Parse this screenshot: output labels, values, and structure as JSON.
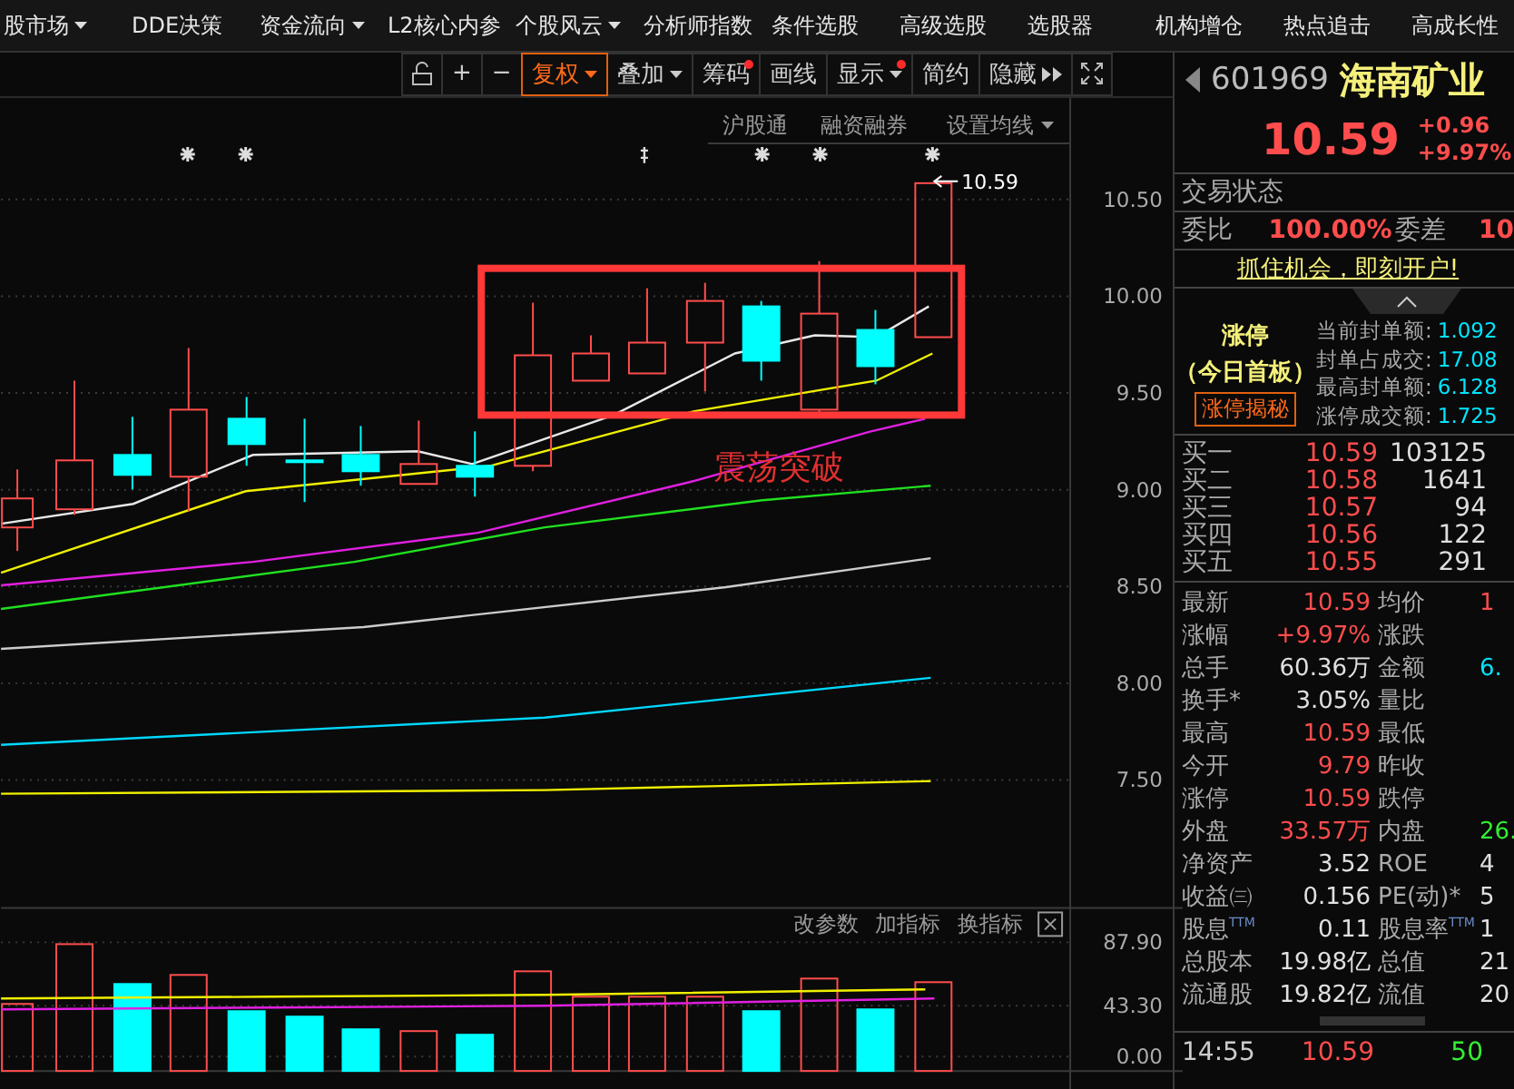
{
  "menu": [
    {
      "label": "股市场",
      "dropdown": true
    },
    {
      "label": "DDE决策",
      "dropdown": false
    },
    {
      "label": "资金流向",
      "dropdown": true
    },
    {
      "label": "L2核心内参",
      "dropdown": false
    },
    {
      "label": "个股风云",
      "dropdown": true
    },
    {
      "label": "分析师指数",
      "dropdown": false
    },
    {
      "label": "条件选股",
      "dropdown": false
    },
    {
      "label": "高级选股",
      "dropdown": false
    },
    {
      "label": "选股器",
      "dropdown": false
    },
    {
      "label": "机构增仓",
      "dropdown": false
    },
    {
      "label": "热点追击",
      "dropdown": false
    },
    {
      "label": "高成长性",
      "dropdown": false
    }
  ],
  "toolbar": [
    {
      "label": "+",
      "selected": false,
      "dropdown": false,
      "alert": false,
      "more": false
    },
    {
      "label": "−",
      "selected": false,
      "dropdown": false,
      "alert": false,
      "more": false
    },
    {
      "label": "复权",
      "selected": true,
      "dropdown": true,
      "alert": false,
      "more": false
    },
    {
      "label": "叠加",
      "selected": false,
      "dropdown": true,
      "alert": false,
      "more": false
    },
    {
      "label": "筹码",
      "selected": false,
      "dropdown": false,
      "alert": true,
      "more": false
    },
    {
      "label": "画线",
      "selected": false,
      "dropdown": false,
      "alert": false,
      "more": false
    },
    {
      "label": "显示",
      "selected": false,
      "dropdown": true,
      "alert": true,
      "more": false
    },
    {
      "label": "简约",
      "selected": false,
      "dropdown": false,
      "alert": false,
      "more": false
    },
    {
      "label": "隐藏",
      "selected": false,
      "dropdown": false,
      "alert": false,
      "more": true
    }
  ],
  "chart": {
    "links": [
      {
        "label": "沪股通",
        "dropdown": false
      },
      {
        "label": "融资融券",
        "dropdown": false
      },
      {
        "label": "设置均线",
        "dropdown": true
      }
    ],
    "price_ticks": [
      "10.50",
      "10.00",
      "9.50",
      "9.00",
      "8.50",
      "8.00",
      "7.50"
    ],
    "last_price_label": "10.59",
    "annotation": "震荡突破"
  },
  "volume": {
    "buttons": [
      "改参数",
      "加指标",
      "换指标"
    ],
    "ticks": [
      "87.90",
      "43.30",
      "0.00"
    ]
  },
  "quote": {
    "code": "601969",
    "name": "海南矿业",
    "price": "10.59",
    "change": "+0.96",
    "change_pct": "+9.97%",
    "status_label": "交易状态",
    "ratio_label": "委比",
    "ratio": "100.00%",
    "diff_label": "委差",
    "diff": "10",
    "promo": "抓住机会，即刻开户!",
    "limit": {
      "title": "涨停",
      "subtitle": "（今日首板）",
      "button": "涨停揭秘",
      "stats": [
        {
          "label": "当前封单额:",
          "value": "1.092"
        },
        {
          "label": "封单占成交:",
          "value": "17.08"
        },
        {
          "label": "最高封单额:",
          "value": "6.128"
        },
        {
          "label": "涨停成交额:",
          "value": "1.725"
        }
      ]
    },
    "bids": [
      {
        "label": "买一",
        "price": "10.59",
        "volume": "103125"
      },
      {
        "label": "买二",
        "price": "10.58",
        "volume": "1641"
      },
      {
        "label": "买三",
        "price": "10.57",
        "volume": "94"
      },
      {
        "label": "买四",
        "price": "10.56",
        "volume": "122"
      },
      {
        "label": "买五",
        "price": "10.55",
        "volume": "291"
      }
    ],
    "stats": [
      [
        {
          "label": "最新",
          "value": "10.59",
          "color": "#ff4d4d"
        },
        {
          "label": "均价",
          "value": "1",
          "color": "#ff4d4d"
        }
      ],
      [
        {
          "label": "涨幅",
          "value": "+9.97%",
          "color": "#ff4d4d"
        },
        {
          "label": "涨跌"
        }
      ],
      [
        {
          "label": "总手",
          "value": "60.36万",
          "color": "#e0e0e0"
        },
        {
          "label": "金额",
          "value": "6.",
          "color": "#00e5ff"
        }
      ],
      [
        {
          "label": "换手*",
          "value": "3.05%",
          "color": "#e0e0e0"
        },
        {
          "label": "量比"
        }
      ],
      [
        {
          "label": "最高",
          "value": "10.59",
          "color": "#ff4d4d"
        },
        {
          "label": "最低"
        }
      ],
      [
        {
          "label": "今开",
          "value": "9.79",
          "color": "#ff4d4d"
        },
        {
          "label": "昨收"
        }
      ],
      [
        {
          "label": "涨停",
          "value": "10.59",
          "color": "#ff4d4d"
        },
        {
          "label": "跌停"
        }
      ],
      [
        {
          "label": "外盘",
          "value": "33.57万",
          "color": "#ff4d4d"
        },
        {
          "label": "内盘",
          "value": "26.",
          "color": "#33ee33"
        }
      ],
      [
        {
          "label": "净资产",
          "value": "3.52",
          "color": "#e0e0e0"
        },
        {
          "label": "ROE",
          "value": "4",
          "color": "#e0e0e0"
        }
      ],
      [
        {
          "label": "收益㈢",
          "value": "0.156",
          "color": "#e0e0e0"
        },
        {
          "label": "PE(动)*",
          "value": "5",
          "color": "#e0e0e0"
        }
      ],
      [
        {
          "label": "股息$^{TTM}$",
          "value": "0.11",
          "color": "#e0e0e0"
        },
        {
          "label": "股息率$^{TTM}$",
          "value": "1",
          "color": "#e0e0e0"
        }
      ],
      [
        {
          "label": "总股本",
          "value": "19.98亿",
          "color": "#e0e0e0"
        },
        {
          "label": "总值",
          "value": "21",
          "color": "#e0e0e0"
        }
      ],
      [
        {
          "label": "流通股",
          "value": "19.82亿",
          "color": "#e0e0e0"
        },
        {
          "label": "流值",
          "value": "20",
          "color": "#e0e0e0"
        }
      ]
    ],
    "ticks": [
      {
        "time": "14:55",
        "price": "10.59",
        "volume": "50"
      }
    ]
  }
}
